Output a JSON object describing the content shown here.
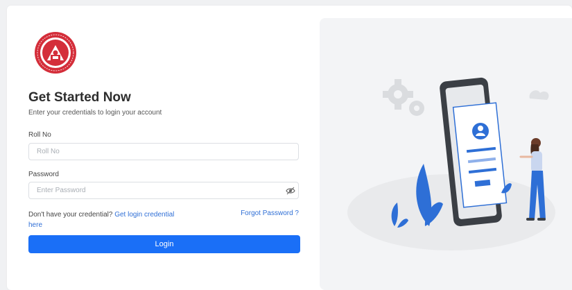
{
  "logo": {
    "icon": "college-seal-icon",
    "color": "#d42e3a"
  },
  "form": {
    "title": "Get Started Now",
    "subtitle": "Enter your credentials to login your account",
    "roll_label": "Roll No",
    "roll_placeholder": "Roll No",
    "roll_value": "",
    "password_label": "Password",
    "password_placeholder": "Enter Password",
    "password_value": "",
    "no_credential_text": "Don't have your credential?",
    "get_credential_link": "Get login credential here",
    "forgot_link": "Forgot Password ?",
    "login_label": "Login"
  },
  "colors": {
    "primary": "#1a6ff7",
    "link": "#2f6fd6",
    "illustration_blue": "#2e6fd6",
    "illustration_dark": "#3b3f45"
  },
  "illustration": {
    "icon": "login-phone-illustration"
  }
}
